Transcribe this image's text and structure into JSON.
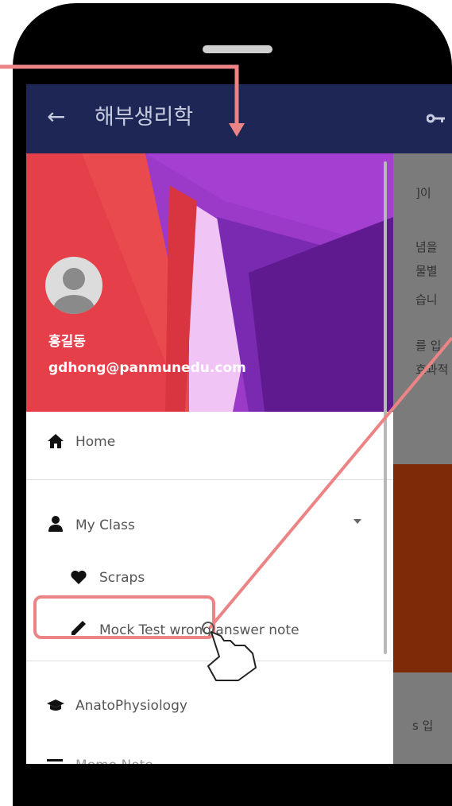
{
  "app_bar": {
    "back_icon": "arrow-left-icon",
    "title": "해부생리학",
    "key_icon": "key-icon"
  },
  "background_content": {
    "lines": [
      "]이",
      "념을",
      "물별",
      "습니",
      "를 입",
      "효과적",
      "s 입"
    ]
  },
  "drawer": {
    "user": {
      "name": "홍길동",
      "email": "gdhong@panmunedu.com",
      "avatar_icon": "person-avatar-icon"
    },
    "items": [
      {
        "label": "Home",
        "icon": "home-icon"
      },
      {
        "label": "My Class",
        "icon": "person-icon",
        "expand_icon": "caret-down-icon"
      },
      {
        "label": "Scraps",
        "icon": "heart-icon"
      },
      {
        "label": "Mock Test wrong answer note",
        "icon": "pencil-icon"
      },
      {
        "label": "AnatoPhysiology",
        "icon": "graduation-cap-icon"
      },
      {
        "label": "Memo Note",
        "icon": "notes-icon"
      }
    ]
  },
  "colors": {
    "app_bar": "#1d2654",
    "annotation": "#ec8486",
    "header_purple": "#9b3ac9",
    "header_red": "#e74b4f"
  }
}
